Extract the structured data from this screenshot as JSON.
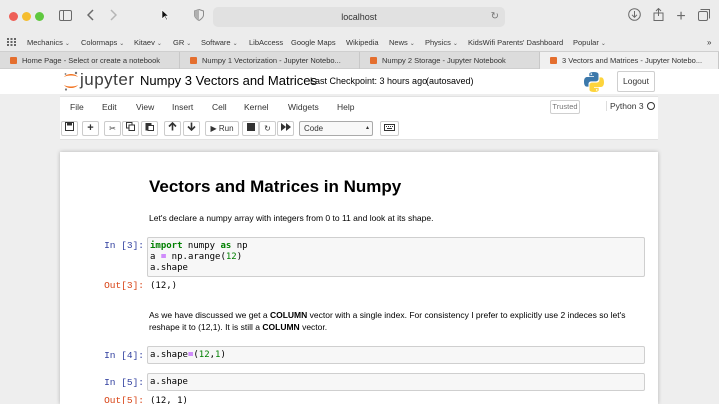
{
  "browser": {
    "url": "localhost"
  },
  "bookmarks": [
    {
      "label": "Mechanics",
      "dropdown": true
    },
    {
      "label": "Colormaps",
      "dropdown": true
    },
    {
      "label": "Kitaev",
      "dropdown": true
    },
    {
      "label": "GR",
      "dropdown": true
    },
    {
      "label": "Software",
      "dropdown": true
    },
    {
      "label": "LibAccess",
      "dropdown": false
    },
    {
      "label": "Google Maps",
      "dropdown": false
    },
    {
      "label": "Wikipedia",
      "dropdown": false
    },
    {
      "label": "News",
      "dropdown": true
    },
    {
      "label": "Physics",
      "dropdown": true
    },
    {
      "label": "KidsWifi Parents' Dashboard",
      "dropdown": false
    },
    {
      "label": "Popular",
      "dropdown": true
    }
  ],
  "tabs": [
    {
      "label": "Home Page - Select or create a notebook",
      "active": false
    },
    {
      "label": "Numpy 1 Vectorization - Jupyter Notebo...",
      "active": false
    },
    {
      "label": "Numpy 2 Storage - Jupyter Notebook",
      "active": false
    },
    {
      "label": "3 Vectors and Matrices - Jupyter Notebo...",
      "active": true
    }
  ],
  "jupyter": {
    "logo_text": "jupyter",
    "notebook_title": "Numpy 3 Vectors and Matrices",
    "checkpoint": "Last Checkpoint: 3 hours ago",
    "autosave": "(autosaved)",
    "logout_label": "Logout",
    "trusted_label": "Trusted",
    "kernel": "Python 3"
  },
  "menu": [
    "File",
    "Edit",
    "View",
    "Insert",
    "Cell",
    "Kernel",
    "Widgets",
    "Help"
  ],
  "toolbar": {
    "run_label": "Run",
    "cell_type": "Code"
  },
  "cells": {
    "heading": "Vectors and Matrices in Numpy",
    "intro": "Let's declare a numpy array with integers from 0 to 11 and look at its shape.",
    "in3_prompt": "In [3]:",
    "in3_line1_kw1": "import",
    "in3_line1_mid": " numpy ",
    "in3_line1_kw2": "as",
    "in3_line1_end": " np",
    "in3_line2_a": "a ",
    "in3_line2_eq": "=",
    "in3_line2_b": " np.arange(",
    "in3_line2_num": "12",
    "in3_line2_c": ")",
    "in3_line3": "a.shape",
    "out3_prompt": "Out[3]:",
    "out3_text": "(12,)",
    "para2_a": "As we have discussed we get a ",
    "para2_b1": "COLUMN",
    "para2_c": " vector with a single index. For consistency I prefer to explicitly use 2 indeces so let's reshape it to (12,1). It is still a ",
    "para2_b2": "COLUMN",
    "para2_d": " vector.",
    "in4_prompt": "In [4]:",
    "in4_a": "a.shape",
    "in4_eq": "=",
    "in4_b": "(",
    "in4_n1": "12",
    "in4_c": ",",
    "in4_n2": "1",
    "in4_d": ")",
    "in5_prompt": "In [5]:",
    "in5_code": "a.shape",
    "out5_prompt": "Out[5]:",
    "out5_text": "(12, 1)"
  },
  "colors": {
    "prompt_in": "#303f9f",
    "prompt_out": "#d84315",
    "keyword": "#008000",
    "operator": "#aa22ff"
  }
}
